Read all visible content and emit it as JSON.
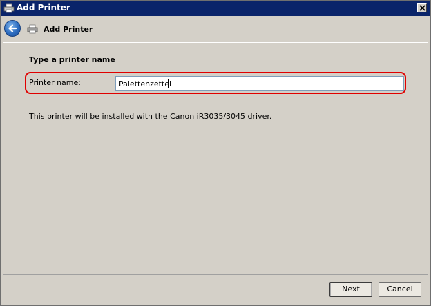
{
  "window": {
    "title": "Add Printer",
    "icons": {
      "title": "printer-icon",
      "close": "close-icon"
    }
  },
  "header": {
    "title": "Add Printer",
    "back_icon": "back-arrow-icon",
    "printer_icon": "printer-icon"
  },
  "main": {
    "section_title": "Type a printer name",
    "printer_name_label": "Printer name:",
    "printer_name_value": "Palettenzettel",
    "info_text": "This printer will be installed with the Canon iR3035/3045 driver.",
    "highlight_color": "#e00000"
  },
  "footer": {
    "next_label": "Next",
    "cancel_label": "Cancel"
  },
  "colors": {
    "titlebar": "#0a246a",
    "window_bg": "#d4d0c8"
  }
}
